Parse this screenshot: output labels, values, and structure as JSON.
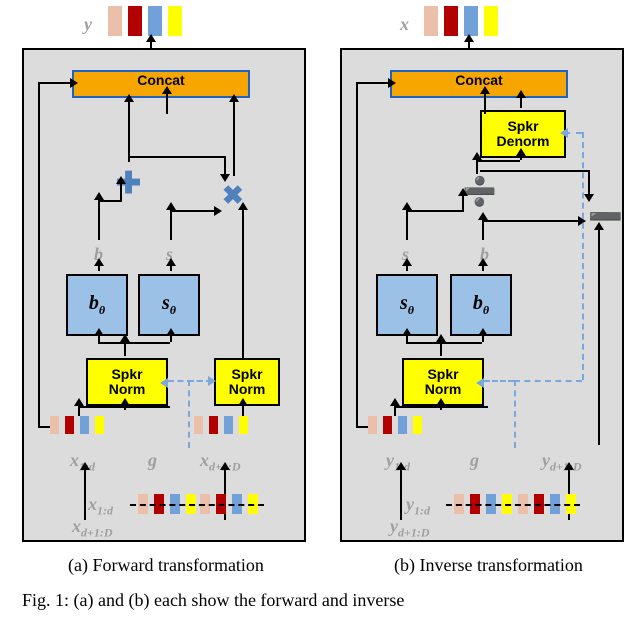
{
  "top": {
    "y_label": "y",
    "x_label": "x"
  },
  "common": {
    "concat": "Concat",
    "spkr_norm": "Spkr\nNorm",
    "spkr_denorm": "Spkr\nDenorm",
    "b_theta": "bθ",
    "s_theta": "sθ",
    "b": "b",
    "s": "s",
    "plus": "✚",
    "times": "✖",
    "div": "➗",
    "minus": "➖",
    "g": "g"
  },
  "left": {
    "x1d": "x",
    "x1d_sub": "1:d",
    "xd1D": "x",
    "xd1D_sub": "d+1:D",
    "split_top": "x",
    "split_top_sub": "1:d",
    "split_bot": "x",
    "split_bot_sub": "d+1:D",
    "caption": "(a) Forward transformation"
  },
  "right": {
    "y1d": "y",
    "y1d_sub": "1:d",
    "yd1D": "y",
    "yd1D_sub": "d+1:D",
    "split_top": "y",
    "split_top_sub": "1:d",
    "split_bot": "y",
    "split_bot_sub": "d+1:D",
    "caption": "(b) Inverse transformation"
  },
  "figure": "Fig. 1:  (a) and (b) each show the forward and inverse"
}
